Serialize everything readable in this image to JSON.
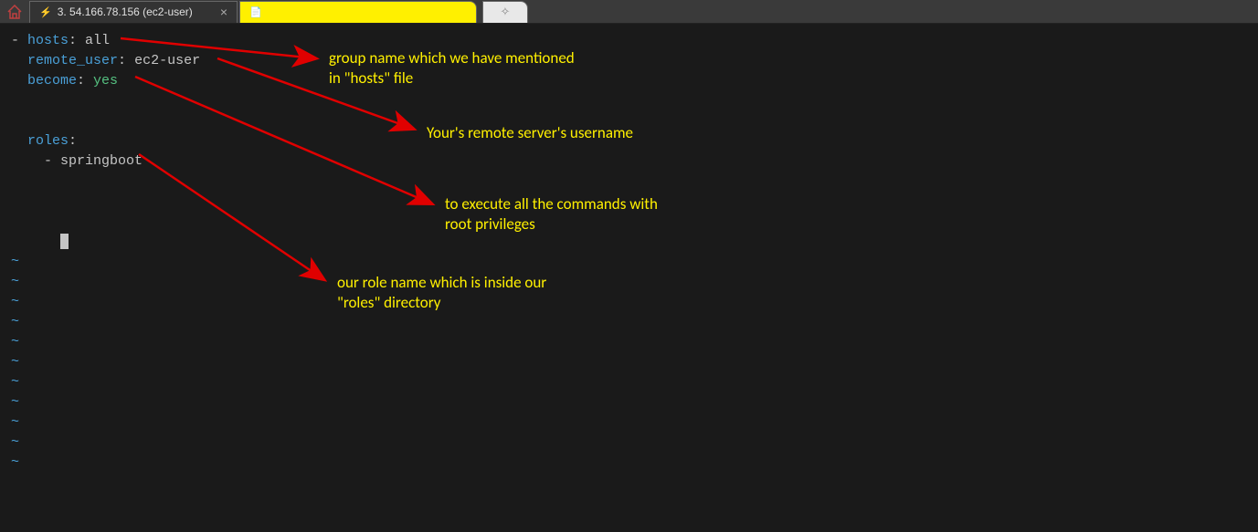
{
  "tabs": {
    "active_title": "3. 54.166.78.156 (ec2-user)",
    "yellow_title": ""
  },
  "code": {
    "line1": {
      "dash": "- ",
      "key": "hosts",
      "colon": ": ",
      "value": "all"
    },
    "line2": {
      "indent": "  ",
      "key": "remote_user",
      "colon": ": ",
      "value": "ec2-user"
    },
    "line3": {
      "indent": "  ",
      "key": "become",
      "colon": ": ",
      "value": "yes"
    },
    "line4": {
      "indent": "  ",
      "key": "roles",
      "colon": ":"
    },
    "line5": {
      "indent": "    ",
      "dash": "- ",
      "value": "springboot"
    }
  },
  "annotations": {
    "a1": "group name which we have mentioned\nin \"hosts\" file",
    "a2": "Your's remote server's username",
    "a3": "to execute all the commands  with\nroot privileges",
    "a4": "our role name which is inside our\n\"roles\" directory"
  },
  "tilde": "~"
}
